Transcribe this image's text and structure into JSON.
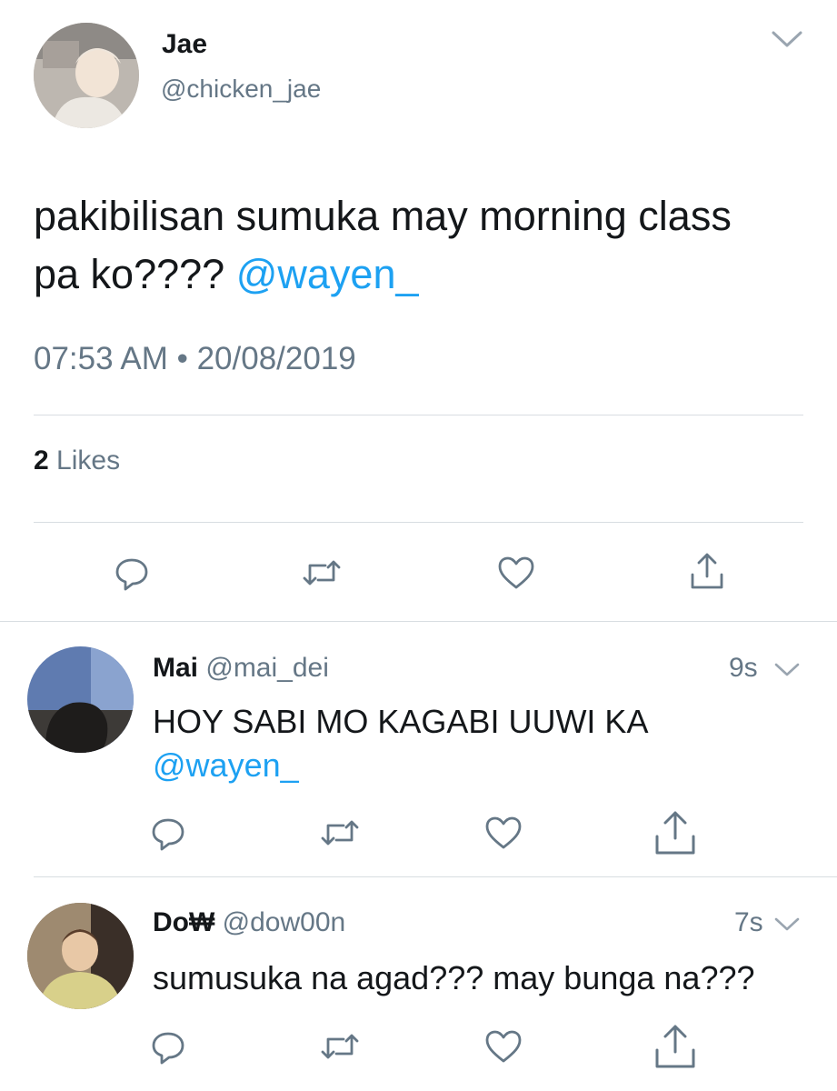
{
  "main_tweet": {
    "author_name": "Jae",
    "author_handle": "@chicken_jae",
    "text": "pakibilisan sumuka may morning class pa ko????",
    "mention": "@wayen_",
    "timestamp": "07:53 AM • 20/08/2019",
    "likes_count": "2",
    "likes_label": "Likes"
  },
  "replies": [
    {
      "author_name": "Mai",
      "author_handle": "@mai_dei",
      "time": "9s",
      "text": "HOY SABI MO KAGABI UUWI KA",
      "mention": "@wayen_"
    },
    {
      "author_name": "Do₩",
      "author_handle": "@dow00n",
      "time": "7s",
      "text": "sumusuka na agad??? may bunga na???"
    }
  ],
  "icons": {
    "chevron": "chevron-down-icon",
    "reply": "reply-icon",
    "retweet": "retweet-icon",
    "like": "heart-icon",
    "share": "share-icon"
  },
  "colors": {
    "text": "#14171a",
    "muted": "#657786",
    "link": "#1da1f2",
    "divider": "#d8dde1"
  }
}
